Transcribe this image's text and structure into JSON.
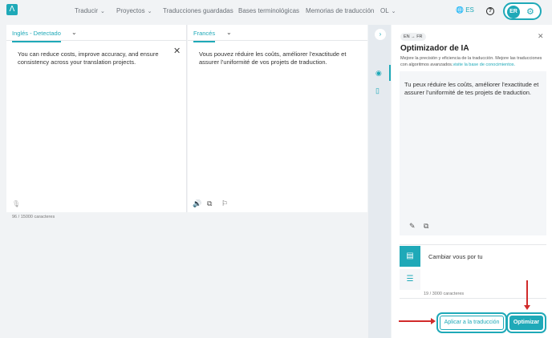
{
  "header": {
    "logo": "Λ",
    "nav": [
      {
        "label": "Traducir",
        "chevron": true
      },
      {
        "label": "Proyectos",
        "chevron": true
      },
      {
        "label": "Traducciones guardadas",
        "chevron": false
      },
      {
        "label": "Bases terminológicas",
        "chevron": false
      },
      {
        "label": "Memorias de traducción",
        "chevron": false
      },
      {
        "label": "OL",
        "chevron": true
      }
    ],
    "language": "ES",
    "help": "?",
    "avatar": "ER"
  },
  "source": {
    "tab_label": "Inglés - Detectado",
    "text": "You can reduce costs, improve accuracy, and ensure consistency across your translation projects.",
    "char_count": "96 / 15000 caracteres"
  },
  "target": {
    "tab_label": "Francés",
    "text": "Vous pouvez réduire les coûts, améliorer l’exactitude et assurer l’uniformité de vos projets de traduction."
  },
  "sidebar": {
    "lang_pair": "EN → FR",
    "title": "Optimizador de IA",
    "description": "Mejore la precisión y eficiencia de la traducción. Mejore las traducciones con algoritmos avanzados.",
    "description_link": "visite la base de conocimientos.",
    "result_text": "Tu peux réduire les coûts, améliorer l’exactitude et assurer l’uniformité de tes projets de traduction.",
    "instruction": "Cambiar vous por tu",
    "instruction_count": "19 / 3000 caracteres",
    "apply_label": "Aplicar a la traducción",
    "optimize_label": "Optimizar"
  },
  "colors": {
    "accent": "#1fa9b8",
    "annotation": "#d12b2b"
  }
}
